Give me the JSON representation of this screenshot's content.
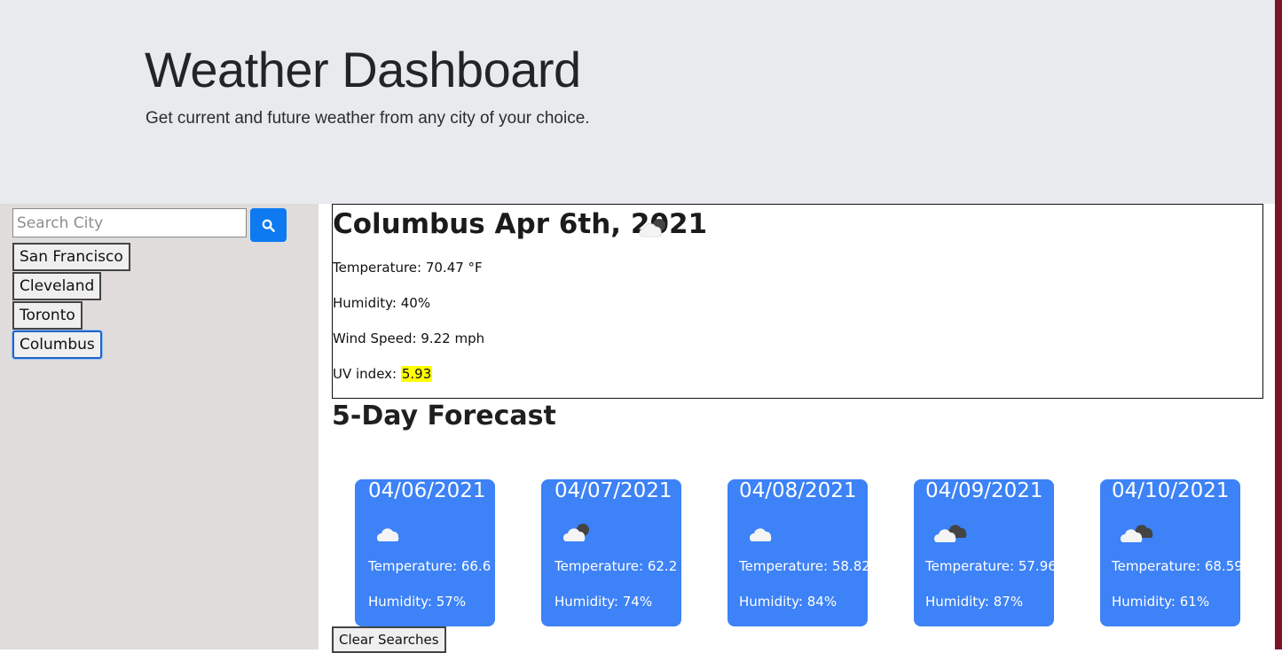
{
  "header": {
    "title": "Weather Dashboard",
    "subtitle": "Get current and future weather from any city of your choice."
  },
  "search": {
    "placeholder": "Search City",
    "value": "",
    "button_icon": "search-icon"
  },
  "history": [
    "San Francisco",
    "Cleveland",
    "Toronto",
    "Columbus"
  ],
  "history_active": "Columbus",
  "current": {
    "heading": "Columbus Apr 6th, 2021",
    "icon": "partly-cloudy-night-icon",
    "temperature": "Temperature: 70.47 °F",
    "humidity": "Humidity: 40%",
    "wind": "Wind Speed: 9.22 mph",
    "uv_label": "UV index: ",
    "uv_value": "5.93",
    "uv_color": "#ffff00"
  },
  "forecast": {
    "title": "5-Day Forecast",
    "days": [
      {
        "date": "04/06/2021",
        "icon": "cloud-icon",
        "temp": "Temperature: 66.6",
        "humidity": "Humidity: 57%"
      },
      {
        "date": "04/07/2021",
        "icon": "partly-cloudy-night-icon",
        "temp": "Temperature: 62.2",
        "humidity": "Humidity: 74%"
      },
      {
        "date": "04/08/2021",
        "icon": "cloud-icon",
        "temp": "Temperature: 58.82",
        "humidity": "Humidity: 84%"
      },
      {
        "date": "04/09/2021",
        "icon": "broken-clouds-icon",
        "temp": "Temperature: 57.96",
        "humidity": "Humidity: 87%"
      },
      {
        "date": "04/10/2021",
        "icon": "broken-clouds-icon",
        "temp": "Temperature: 68.59",
        "humidity": "Humidity: 61%"
      }
    ]
  },
  "clear_label": "Clear Searches",
  "colors": {
    "header_bg": "#e9eaee",
    "sidebar_bg": "#dfdcdb",
    "search_button": "#0d7af2",
    "card_bg": "#3d82f6"
  }
}
